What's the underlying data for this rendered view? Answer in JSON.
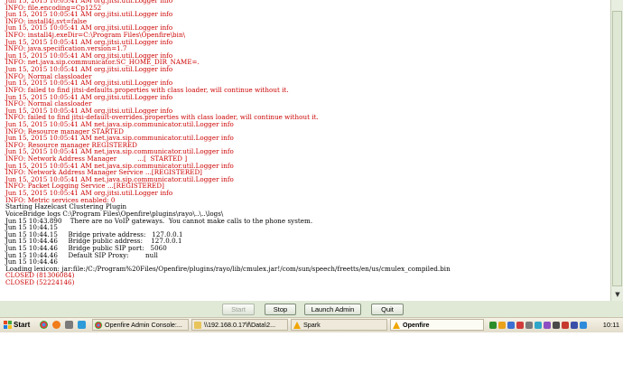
{
  "log": {
    "lines": [
      {
        "text": "Jun 15, 2015 10:05:41 AM org.jitsi.util.Logger info",
        "color": "red"
      },
      {
        "text": "INFO: file.encoding=Cp1252",
        "color": "red"
      },
      {
        "text": "Jun 15, 2015 10:05:41 AM org.jitsi.util.Logger info",
        "color": "red"
      },
      {
        "text": "INFO: install4j.svt=false",
        "color": "red"
      },
      {
        "text": "Jun 15, 2015 10:05:41 AM org.jitsi.util.Logger info",
        "color": "red"
      },
      {
        "text": "INFO: install4j.exeDir=C:\\Program Files\\Openfire\\bin\\",
        "color": "red"
      },
      {
        "text": "Jun 15, 2015 10:05:41 AM org.jitsi.util.Logger info",
        "color": "red"
      },
      {
        "text": "INFO: java.specification.version=1.7",
        "color": "red"
      },
      {
        "text": "Jun 15, 2015 10:05:41 AM org.jitsi.util.Logger info",
        "color": "red"
      },
      {
        "text": "INFO: net.java.sip.communicator.SC_HOME_DIR_NAME=.",
        "color": "red"
      },
      {
        "text": "Jun 15, 2015 10:05:41 AM org.jitsi.util.Logger info",
        "color": "red"
      },
      {
        "text": "INFO: Normal classloader",
        "color": "red"
      },
      {
        "text": "Jun 15, 2015 10:05:41 AM org.jitsi.util.Logger info",
        "color": "red"
      },
      {
        "text": "INFO: failed to find jitsi-defaults.properties with class loader, will continue without it.",
        "color": "red"
      },
      {
        "text": "Jun 15, 2015 10:05:41 AM org.jitsi.util.Logger info",
        "color": "red"
      },
      {
        "text": "INFO: Normal classloader",
        "color": "red"
      },
      {
        "text": "Jun 15, 2015 10:05:41 AM org.jitsi.util.Logger info",
        "color": "red"
      },
      {
        "text": "INFO: failed to find jitsi-default-overrides.properties with class loader, will continue without it.",
        "color": "red"
      },
      {
        "text": "Jun 15, 2015 10:05:41 AM net.java.sip.communicator.util.Logger info",
        "color": "red"
      },
      {
        "text": "INFO: Resource manager STARTED",
        "color": "red"
      },
      {
        "text": "Jun 15, 2015 10:05:41 AM net.java.sip.communicator.util.Logger info",
        "color": "red"
      },
      {
        "text": "INFO: Resource manager REGISTERED",
        "color": "red"
      },
      {
        "text": "Jun 15, 2015 10:05:41 AM net.java.sip.communicator.util.Logger info",
        "color": "red"
      },
      {
        "text": "INFO: Network Address Manager          ...[  STARTED ]",
        "color": "red"
      },
      {
        "text": "Jun 15, 2015 10:05:41 AM net.java.sip.communicator.util.Logger info",
        "color": "red"
      },
      {
        "text": "INFO: Network Address Manager Service ...[REGISTERED]",
        "color": "red"
      },
      {
        "text": "Jun 15, 2015 10:05:41 AM net.java.sip.communicator.util.Logger info",
        "color": "red"
      },
      {
        "text": "INFO: Packet Logging Service ...[REGISTERED]",
        "color": "red"
      },
      {
        "text": "Jun 15, 2015 10:05:41 AM org.jitsi.util.Logger info",
        "color": "red"
      },
      {
        "text": "INFO: Metric services enabled: 0",
        "color": "red"
      },
      {
        "text": "Starting Hazelcast Clustering Plugin",
        "color": "black"
      },
      {
        "text": "VoiceBridge logs C:\\Program Files\\Openfire\\plugins\\rayo\\..\\..\\logs\\",
        "color": "black"
      },
      {
        "text": "Jun 15 10:43.890    There are no VoIP gateways.  You cannot make calls to the phone system.",
        "color": "black"
      },
      {
        "text": "Jun 15 10:44.15",
        "color": "black"
      },
      {
        "text": "Jun 15 10:44.15     Bridge private address:   127.0.0.1",
        "color": "black"
      },
      {
        "text": "Jun 15 10:44.46     Bridge public address:    127.0.0.1",
        "color": "black"
      },
      {
        "text": "Jun 15 10:44.46     Bridge public SIP port:   5060",
        "color": "black"
      },
      {
        "text": "Jun 15 10:44.46     Default SIP Proxy:        null",
        "color": "black"
      },
      {
        "text": "Jun 15 10:44.46",
        "color": "black"
      },
      {
        "text": "Loading lexicon: jar:file:/C:/Program%20Files/Openfire/plugins/rayo/lib/cmulex.jar!/com/sun/speech/freetts/en/us/cmulex_compiled.bin",
        "color": "black"
      },
      {
        "text": "CLOSED (81306084)",
        "color": "red"
      },
      {
        "text": "CLOSED (52224146)",
        "color": "red"
      }
    ]
  },
  "buttons": {
    "start": "Start",
    "stop": "Stop",
    "launch_admin": "Launch Admin",
    "quit": "Quit"
  },
  "taskbar": {
    "start_label": "Start",
    "tasks": [
      {
        "label": "Openfire Admin Console:...",
        "icon": "chrome-icon"
      },
      {
        "label": "\\\\192.168.0.17\\f\\Data\\2...",
        "icon": "folder-icon"
      },
      {
        "label": "Spark",
        "icon": "spark-icon"
      },
      {
        "label": "Openfire",
        "icon": "openfire-icon"
      }
    ],
    "clock": "10:11"
  },
  "colors": {
    "log_red": "#cc0000",
    "button_bar_bg": "#dfe9d6",
    "taskbar_bg": "#e9e4d3"
  }
}
